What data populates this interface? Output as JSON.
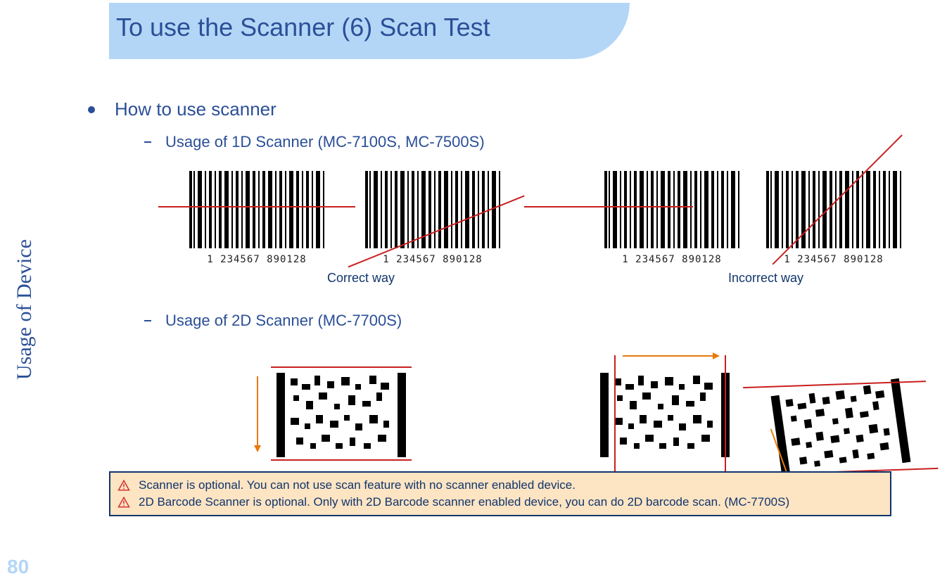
{
  "page_number": "80",
  "side_label": "Usage of Device",
  "title": "To use the Scanner (6) Scan Test",
  "main_bullet": "How to use scanner",
  "sub1": "Usage of 1D Scanner (MC-7100S, MC-7500S)",
  "sub2": "Usage of 2D Scanner (MC-7700S)",
  "barcode_number": "1 234567 890128",
  "caption_correct": "Correct way",
  "caption_incorrect": "Incorrect way",
  "notice1": "Scanner is optional. You can not use scan feature with no scanner enabled device.",
  "notice2": "2D Barcode Scanner is optional. Only with 2D Barcode scanner enabled device,  you can do 2D barcode scan. (MC-7700S)"
}
